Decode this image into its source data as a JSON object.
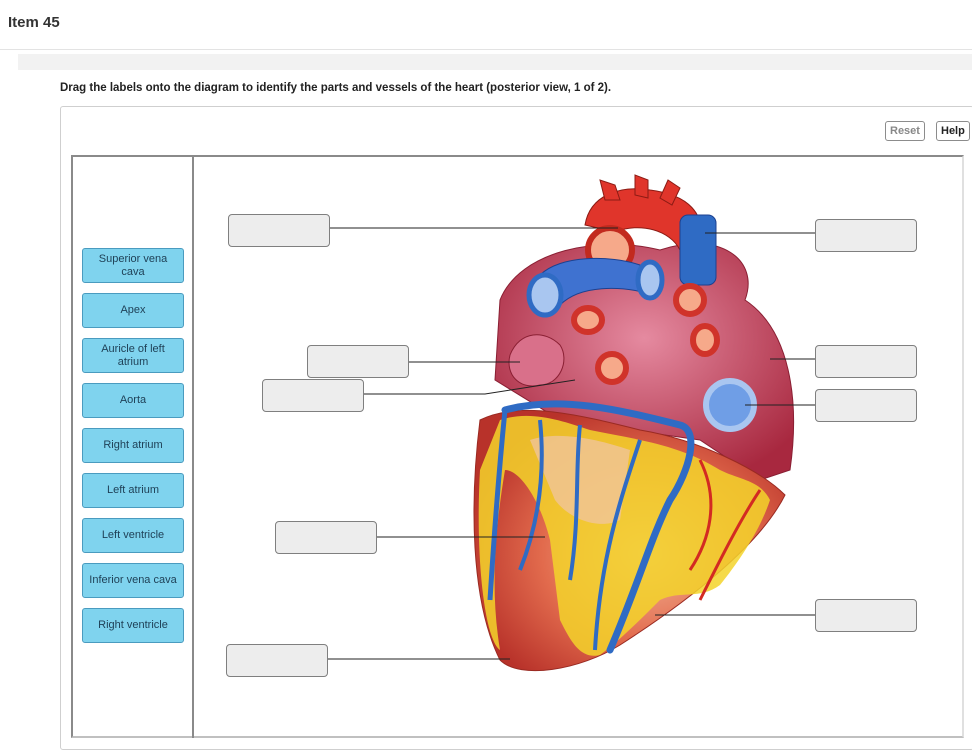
{
  "item": {
    "title": "Item 45"
  },
  "instructions": "Drag the labels onto the diagram to identify the parts and vessels of the heart (posterior view, 1 of 2).",
  "toolbar": {
    "reset_label": "Reset",
    "help_label": "Help"
  },
  "labels": [
    "Superior vena cava",
    "Apex",
    "Auricle of left atrium",
    "Aorta",
    "Right atrium",
    "Left atrium",
    "Left ventricle",
    "Inferior vena cava",
    "Right ventricle"
  ],
  "colors": {
    "chip": "#7fd3ee",
    "artery": "#e0352b",
    "vein": "#2f6bc4",
    "fat": "#f3d32a",
    "muscle": "#d9553c"
  }
}
